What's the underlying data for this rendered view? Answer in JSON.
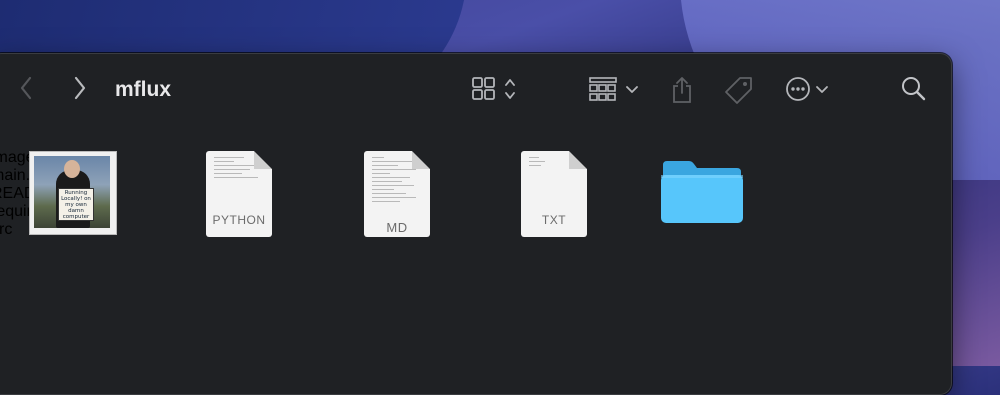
{
  "window": {
    "title": "mflux"
  },
  "toolbar": {
    "back_icon": "chevron-left-icon",
    "forward_icon": "chevron-right-icon",
    "view_icon": "grid-view-icon",
    "group_icon": "group-icon",
    "share_icon": "share-icon",
    "tag_icon": "tag-icon",
    "more_icon": "ellipsis-circle-icon",
    "search_icon": "magnifier-icon"
  },
  "files": [
    {
      "name": "image.png",
      "kind": "image",
      "sign_text": "Running Locally! on my own damn computer"
    },
    {
      "name": "main.py",
      "kind": "document",
      "type_label": "PYTHON"
    },
    {
      "name": "README.md",
      "kind": "document",
      "type_label": "MD"
    },
    {
      "name": "requirements.txt",
      "kind": "document",
      "type_label": "TXT"
    },
    {
      "name": "src",
      "kind": "folder"
    }
  ],
  "colors": {
    "window_bg": "#1f2124",
    "folder_blue": "#57c6fb",
    "text": "#e6e6e8"
  }
}
